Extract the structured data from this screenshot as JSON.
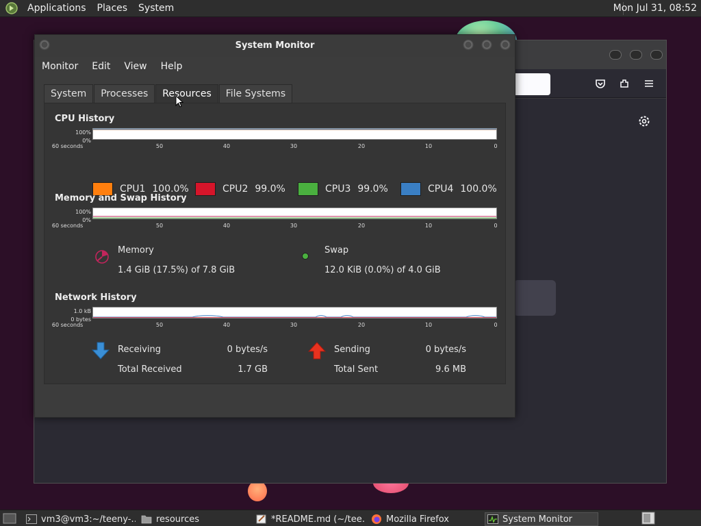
{
  "top_panel": {
    "menus": [
      "Applications",
      "Places",
      "System"
    ],
    "clock": "Mon Jul 31, 08:52"
  },
  "window": {
    "title": "System Monitor",
    "menus": [
      "Monitor",
      "Edit",
      "View",
      "Help"
    ]
  },
  "tabs": [
    {
      "label": "System",
      "active": false
    },
    {
      "label": "Processes",
      "active": false
    },
    {
      "label": "Resources",
      "active": true
    },
    {
      "label": "File Systems",
      "active": false
    }
  ],
  "cpu_history": {
    "title": "CPU History",
    "y_ticks": [
      "100%",
      "0%"
    ],
    "x_ticks": [
      "60 seconds",
      "50",
      "40",
      "30",
      "20",
      "10",
      "0"
    ],
    "cpus": [
      {
        "name": "CPU1",
        "value": "100.0%",
        "color": "#ff7f0e"
      },
      {
        "name": "CPU2",
        "value": "99.0%",
        "color": "#d6152a"
      },
      {
        "name": "CPU3",
        "value": "99.0%",
        "color": "#4ab03f"
      },
      {
        "name": "CPU4",
        "value": "100.0%",
        "color": "#3a7fc4"
      }
    ]
  },
  "memory_history": {
    "title": "Memory and Swap History",
    "y_ticks": [
      "100%",
      "0%"
    ],
    "x_ticks": [
      "60 seconds",
      "50",
      "40",
      "30",
      "20",
      "10",
      "0"
    ],
    "memory": {
      "label": "Memory",
      "value": "1.4 GiB (17.5%) of 7.8 GiB",
      "color": "#c2255c"
    },
    "swap": {
      "label": "Swap",
      "value": "12.0 KiB (0.0%) of 4.0 GiB",
      "color": "#4ab03f"
    }
  },
  "network_history": {
    "title": "Network History",
    "y_ticks": [
      "1.0 kB",
      "0 bytes"
    ],
    "x_ticks": [
      "60 seconds",
      "50",
      "40",
      "30",
      "20",
      "10",
      "0"
    ],
    "receiving": {
      "label": "Receiving",
      "rate": "0 bytes/s",
      "total_label": "Total Received",
      "total": "1.7 GB"
    },
    "sending": {
      "label": "Sending",
      "rate": "0 bytes/s",
      "total_label": "Total Sent",
      "total": "9.6 MB"
    }
  },
  "taskbar": {
    "items": [
      {
        "label": "vm3@vm3:~/teeny-…",
        "icon": "terminal-icon"
      },
      {
        "label": "resources",
        "icon": "folder-icon"
      },
      {
        "label": "*README.md (~/tee…",
        "icon": "text-editor-icon"
      },
      {
        "label": "Mozilla Firefox",
        "icon": "firefox-icon"
      },
      {
        "label": "System Monitor",
        "icon": "system-monitor-icon",
        "active": true
      }
    ]
  }
}
